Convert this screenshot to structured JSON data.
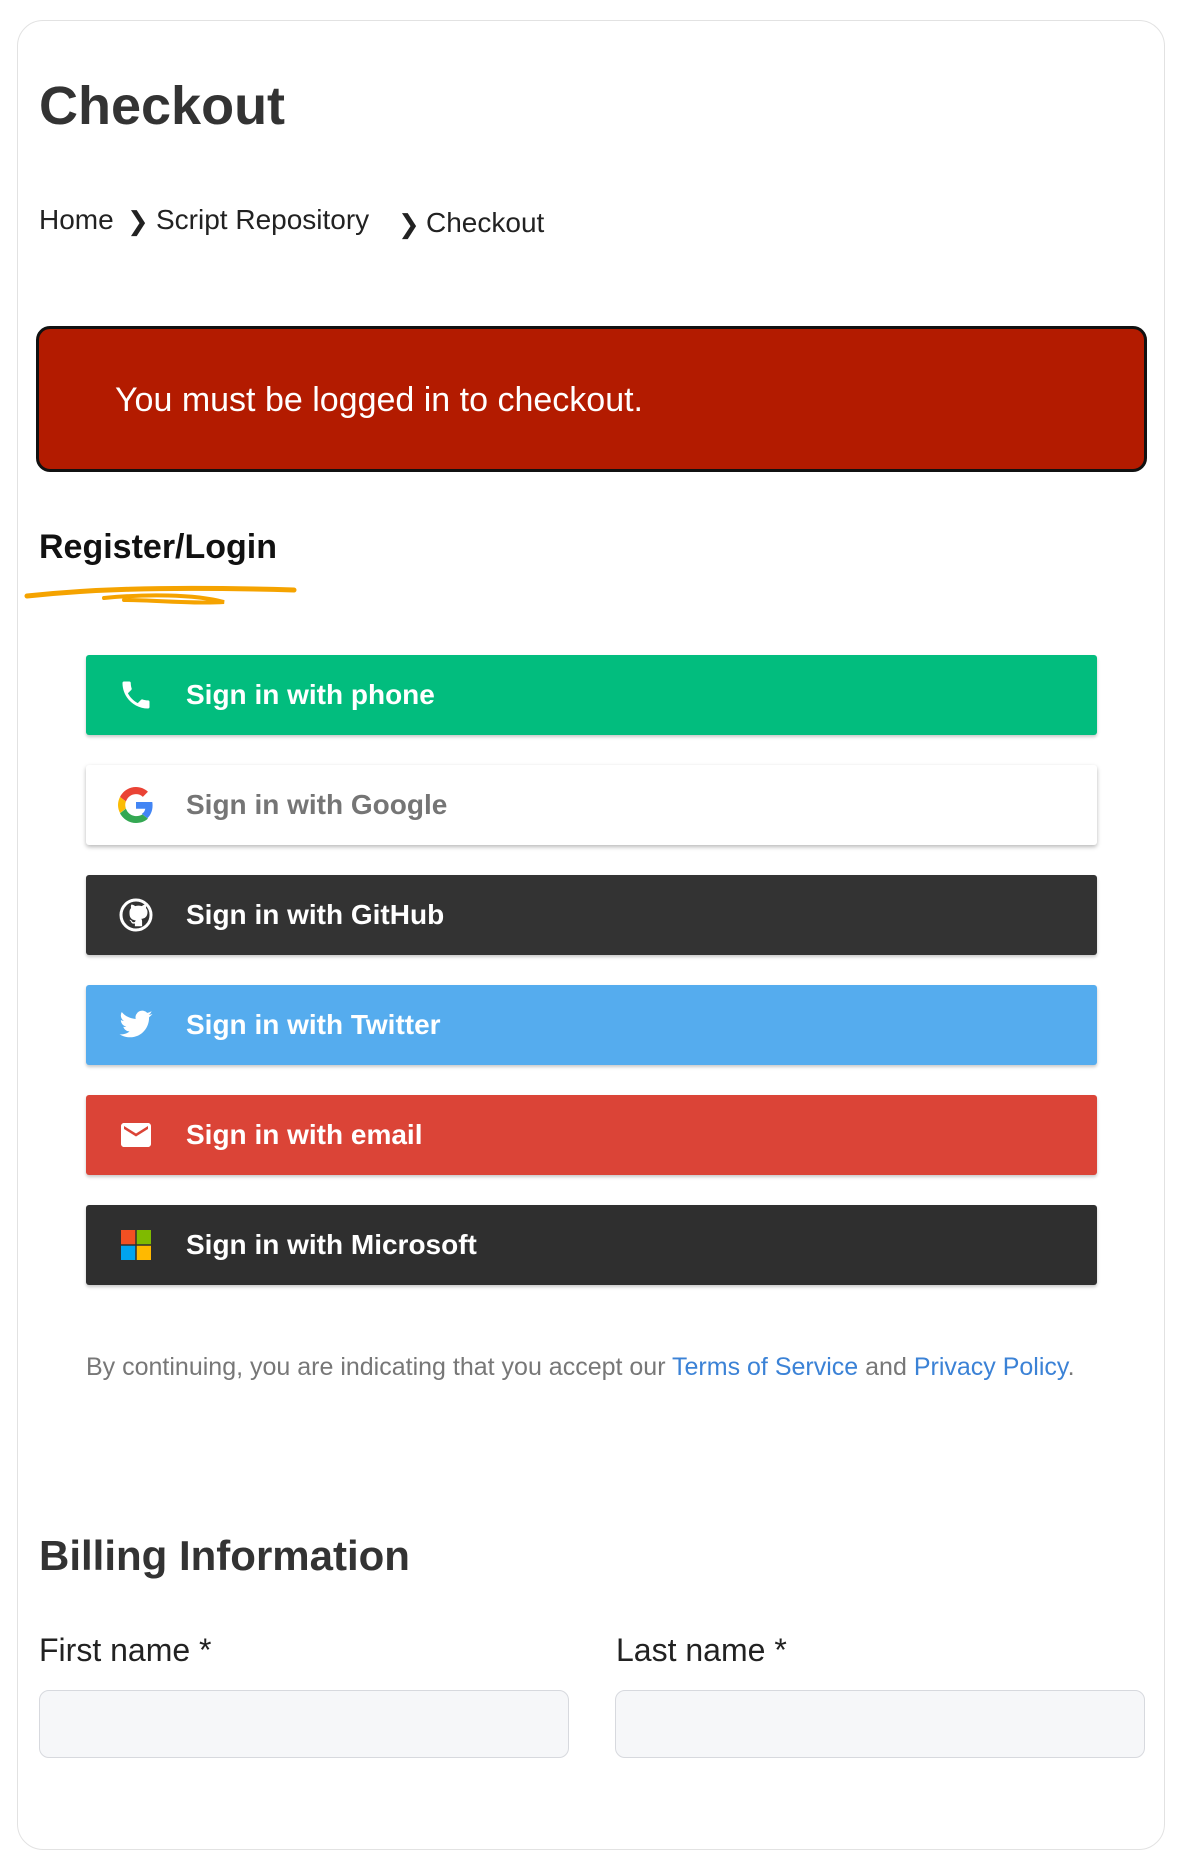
{
  "page": {
    "title": "Checkout"
  },
  "breadcrumb": {
    "items": [
      "Home",
      "Script Repository",
      "Checkout"
    ],
    "separator": "❯"
  },
  "alert": {
    "message": "You must be logged in to checkout.",
    "background": "#b31b00"
  },
  "auth": {
    "heading": "Register/Login",
    "underline_color": "#f5a300",
    "buttons": [
      {
        "id": "phone",
        "label": "Sign in with phone",
        "icon": "phone-icon",
        "color": "#02bd7e"
      },
      {
        "id": "google",
        "label": "Sign in with Google",
        "icon": "google-icon",
        "color": "#ffffff"
      },
      {
        "id": "github",
        "label": "Sign in with GitHub",
        "icon": "github-icon",
        "color": "#333333"
      },
      {
        "id": "twitter",
        "label": "Sign in with Twitter",
        "icon": "twitter-icon",
        "color": "#55acee"
      },
      {
        "id": "email",
        "label": "Sign in with email",
        "icon": "email-icon",
        "color": "#db4437"
      },
      {
        "id": "microsoft",
        "label": "Sign in with Microsoft",
        "icon": "microsoft-icon",
        "color": "#2f2f2f"
      }
    ],
    "tos": {
      "prefix": "By continuing, you are indicating that you accept our ",
      "terms_link": "Terms of Service",
      "middle": " and ",
      "privacy_link": "Privacy Policy",
      "suffix": "."
    }
  },
  "billing": {
    "title": "Billing Information",
    "first_name_label": "First name *",
    "first_name_value": "",
    "last_name_label": "Last name *",
    "last_name_value": ""
  }
}
